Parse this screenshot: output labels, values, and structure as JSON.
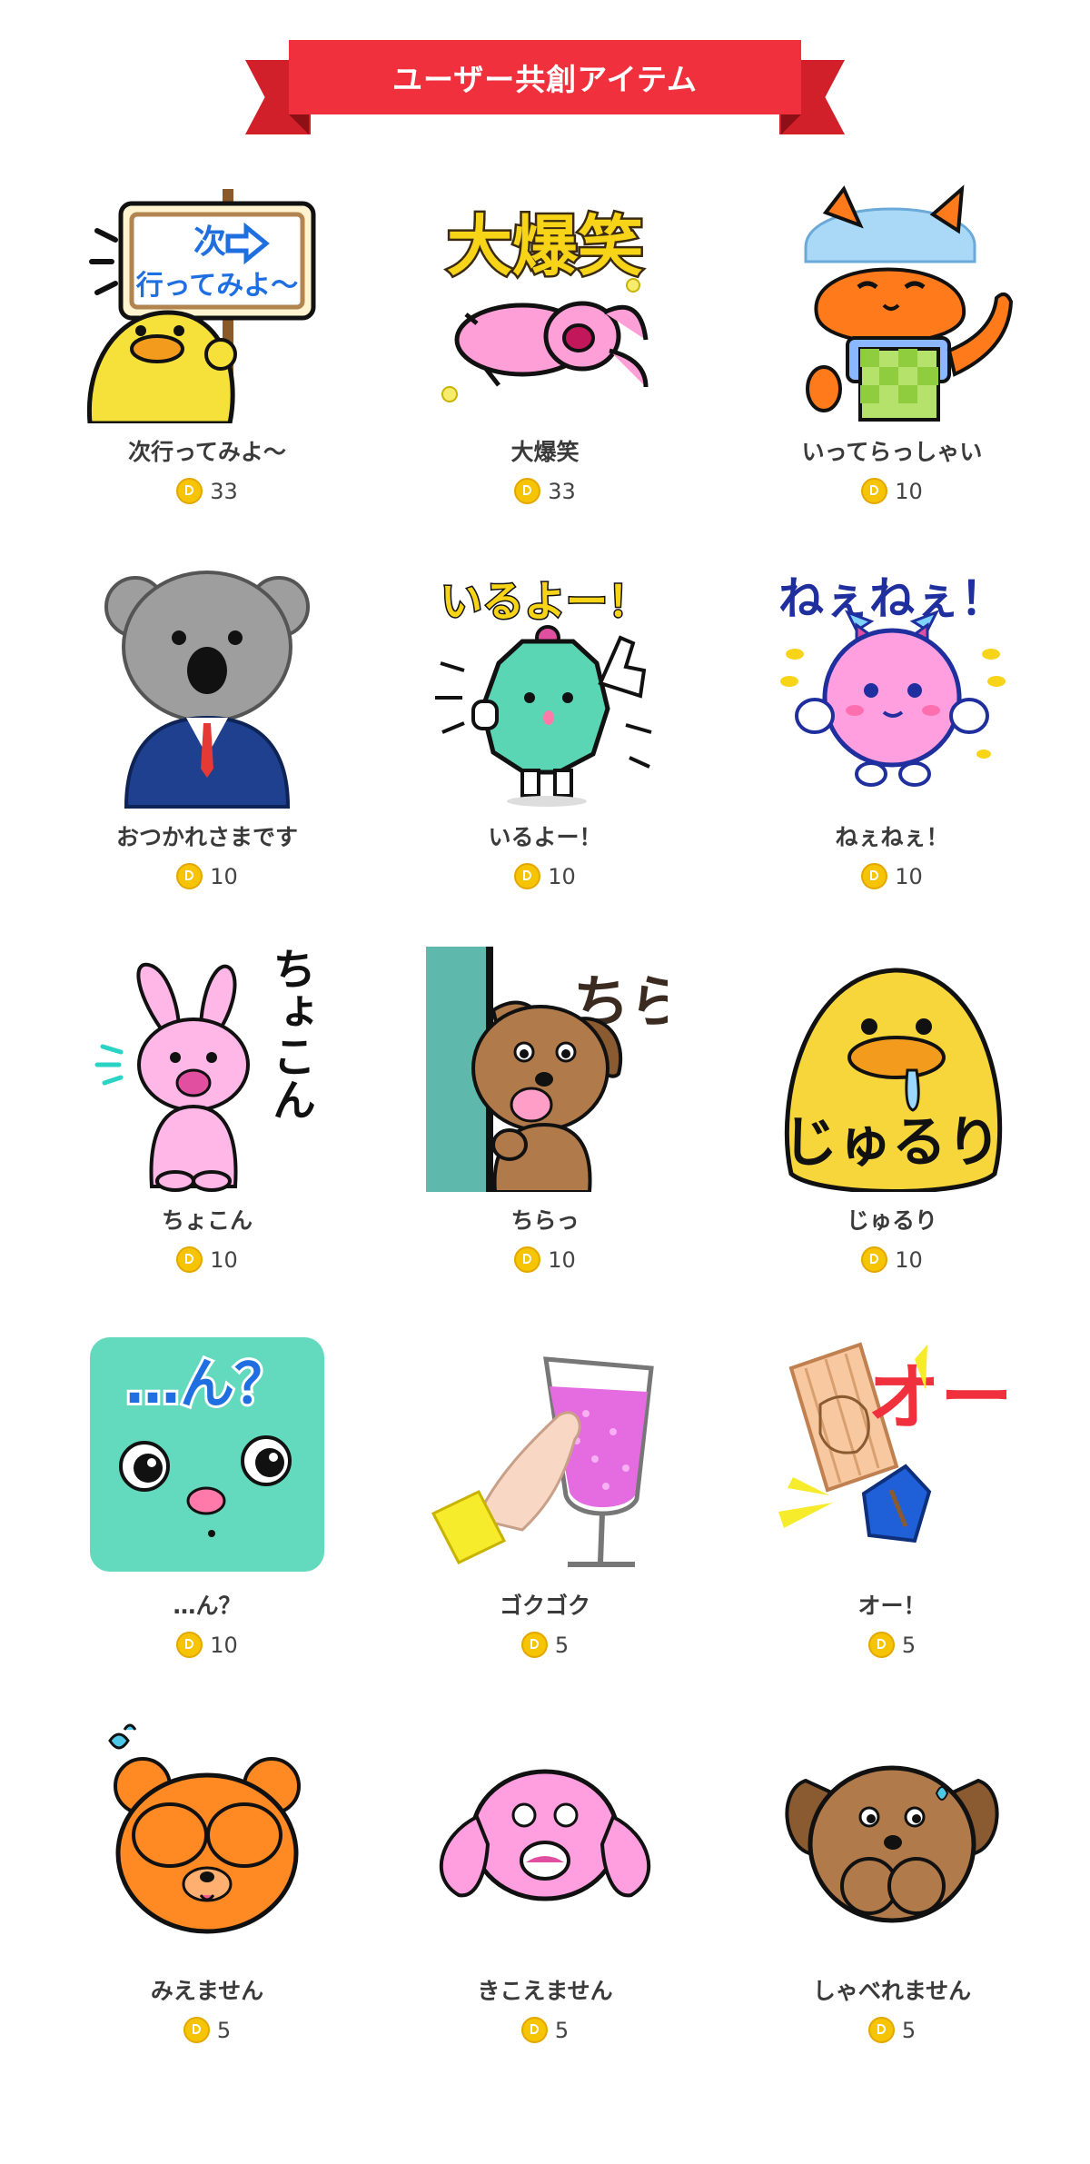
{
  "header": {
    "title": "ユーザー共創アイテム"
  },
  "currency_icon": "coin-icon",
  "colors": {
    "ribbon": "#f0313d",
    "ribbon_dark": "#d2202a",
    "coin": "#f6c400"
  },
  "items": [
    {
      "name": "次行ってみよ～",
      "price": "33",
      "icon": "duck-signboard-sticker",
      "sign_line1": "次",
      "sign_line2": "行ってみよ～"
    },
    {
      "name": "大爆笑",
      "price": "33",
      "icon": "laughing-rabbit-sticker",
      "caption": "大爆笑"
    },
    {
      "name": "いってらっしゃい",
      "price": "10",
      "icon": "cat-apron-sticker"
    },
    {
      "name": "おつかれさまです",
      "price": "10",
      "icon": "koala-suit-sticker"
    },
    {
      "name": "いるよー！",
      "price": "10",
      "icon": "green-monster-sticker",
      "caption": "いるよー！"
    },
    {
      "name": "ねぇねぇ！",
      "price": "10",
      "icon": "pink-monster-sticker",
      "caption": "ねぇねぇ！"
    },
    {
      "name": "ちょこん",
      "price": "10",
      "icon": "sitting-rabbit-sticker",
      "caption": "ちょこん"
    },
    {
      "name": "ちらっ",
      "price": "10",
      "icon": "peeking-dog-sticker",
      "caption": "ちらっ"
    },
    {
      "name": "じゅるり",
      "price": "10",
      "icon": "drooling-duck-sticker",
      "caption": "じゅるり"
    },
    {
      "name": "…ん？",
      "price": "10",
      "icon": "confused-face-sticker",
      "caption": "…ん？"
    },
    {
      "name": "ゴクゴク",
      "price": "5",
      "icon": "drink-glass-sticker"
    },
    {
      "name": "オー！",
      "price": "5",
      "icon": "fist-cheer-sticker",
      "caption": "オー！"
    },
    {
      "name": "みえません",
      "price": "5",
      "icon": "bear-cover-eyes-sticker"
    },
    {
      "name": "きこえません",
      "price": "5",
      "icon": "rabbit-cover-ears-sticker"
    },
    {
      "name": "しゃべれません",
      "price": "5",
      "icon": "dog-cover-mouth-sticker"
    }
  ]
}
